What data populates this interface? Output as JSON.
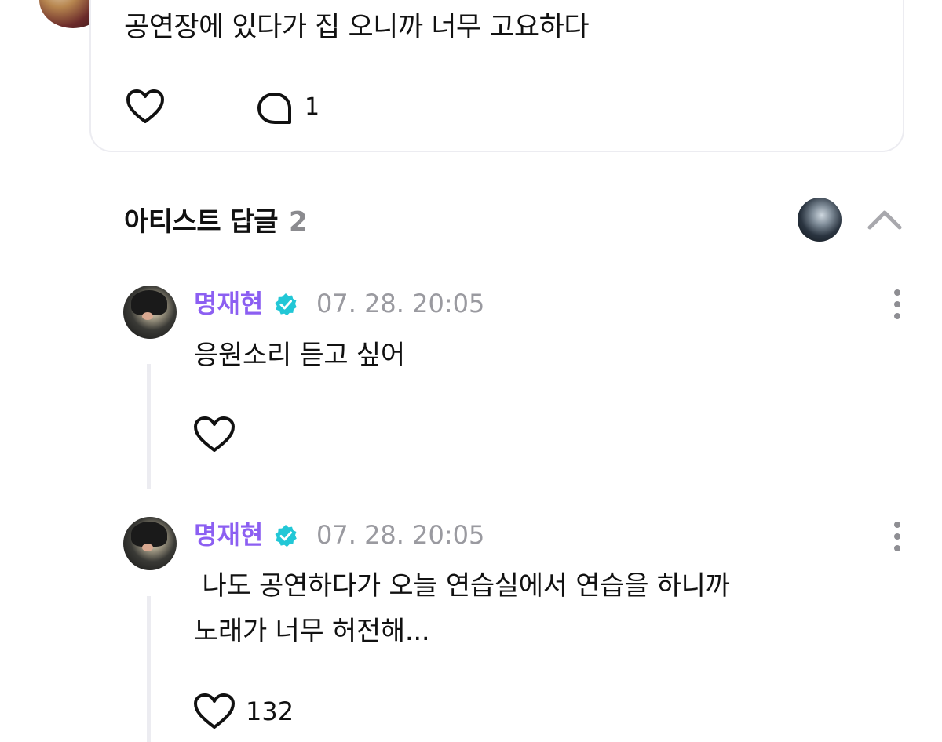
{
  "post": {
    "text": "공연장에 있다가 집 오니까 너무 고요하다",
    "comment_count": "1"
  },
  "artist_replies": {
    "title": "아티스트 답글",
    "count": "2"
  },
  "replies": [
    {
      "author": "명재현",
      "timestamp": "07. 28. 20:05",
      "text": "응원소리 듣고 싶어",
      "like_count": ""
    },
    {
      "author": "명재현",
      "timestamp": "07. 28. 20:05",
      "text_line1": " 나도 공연하다가 오늘 연습실에서 연습을 하니까",
      "text_line2": "노래가 너무 허전해...",
      "like_count": "132"
    }
  ],
  "colors": {
    "author": "#8c5ff2",
    "verified": "#22c7d6",
    "timestamp": "#9a9aa0",
    "card_border": "#ececf1"
  }
}
